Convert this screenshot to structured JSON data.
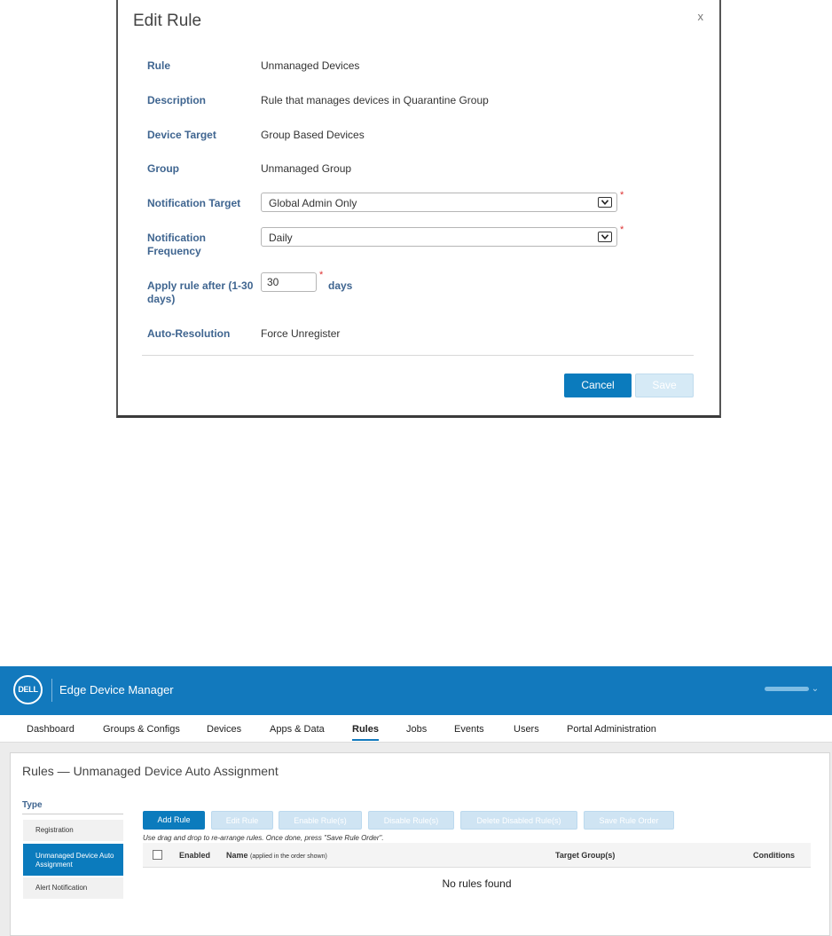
{
  "modal": {
    "title": "Edit Rule",
    "close_label": "x",
    "fields": {
      "rule": {
        "label": "Rule",
        "value": "Unmanaged Devices"
      },
      "description": {
        "label": "Description",
        "value": "Rule that manages devices in Quarantine Group"
      },
      "device_target": {
        "label": "Device Target",
        "value": "Group Based Devices"
      },
      "group": {
        "label": "Group",
        "value": "Unmanaged Group"
      },
      "notification_target": {
        "label": "Notification Target",
        "value": "Global Admin Only"
      },
      "notification_frequency": {
        "label_line1": "Notification",
        "label_line2": "Frequency",
        "value": "Daily"
      },
      "apply_rule_after": {
        "label_line1": "Apply rule after (1-30",
        "label_line2": "days)",
        "value": "30",
        "unit": "days"
      },
      "auto_resolution": {
        "label": "Auto-Resolution",
        "value": "Force Unregister"
      }
    },
    "required_marker": "*",
    "buttons": {
      "cancel": "Cancel",
      "save": "Save"
    }
  },
  "portal": {
    "brand": {
      "logo_text": "DELL",
      "app_name": "Edge Device Manager"
    },
    "user_menu_caret": "⌄",
    "nav": [
      {
        "label": "Dashboard"
      },
      {
        "label": "Groups & Configs"
      },
      {
        "label": "Devices"
      },
      {
        "label": "Apps & Data"
      },
      {
        "label": "Rules"
      },
      {
        "label": "Jobs"
      },
      {
        "label": "Events"
      },
      {
        "label": "Users"
      },
      {
        "label": "Portal Administration"
      }
    ],
    "active_nav": "Rules",
    "page_title": "Rules — Unmanaged Device Auto Assignment",
    "type_panel": {
      "heading": "Type",
      "items": [
        {
          "label": "Registration"
        },
        {
          "label_line1": "Unmanaged Device Auto",
          "label_line2": "Assignment"
        },
        {
          "label": "Alert Notification"
        }
      ]
    },
    "toolbar": {
      "add_rule": "Add Rule",
      "edit_rule": "Edit Rule",
      "enable_rules": "Enable Rule(s)",
      "disable_rules": "Disable Rule(s)",
      "delete_disabled_rules": "Delete Disabled Rule(s)",
      "save_rule_order": "Save Rule Order"
    },
    "hint": "Use drag and drop to re-arrange rules. Once done, press \"Save Rule Order\".",
    "table": {
      "columns": {
        "enabled": "Enabled",
        "name": "Name",
        "name_note": "(applied in the order shown)",
        "target_groups": "Target Group(s)",
        "conditions": "Conditions"
      },
      "empty_message": "No rules found"
    },
    "colors": {
      "brand_blue": "#1279bd",
      "button_blue": "#0b7bbd",
      "label_blue": "#3f6590",
      "required_red": "#dd3333"
    }
  }
}
